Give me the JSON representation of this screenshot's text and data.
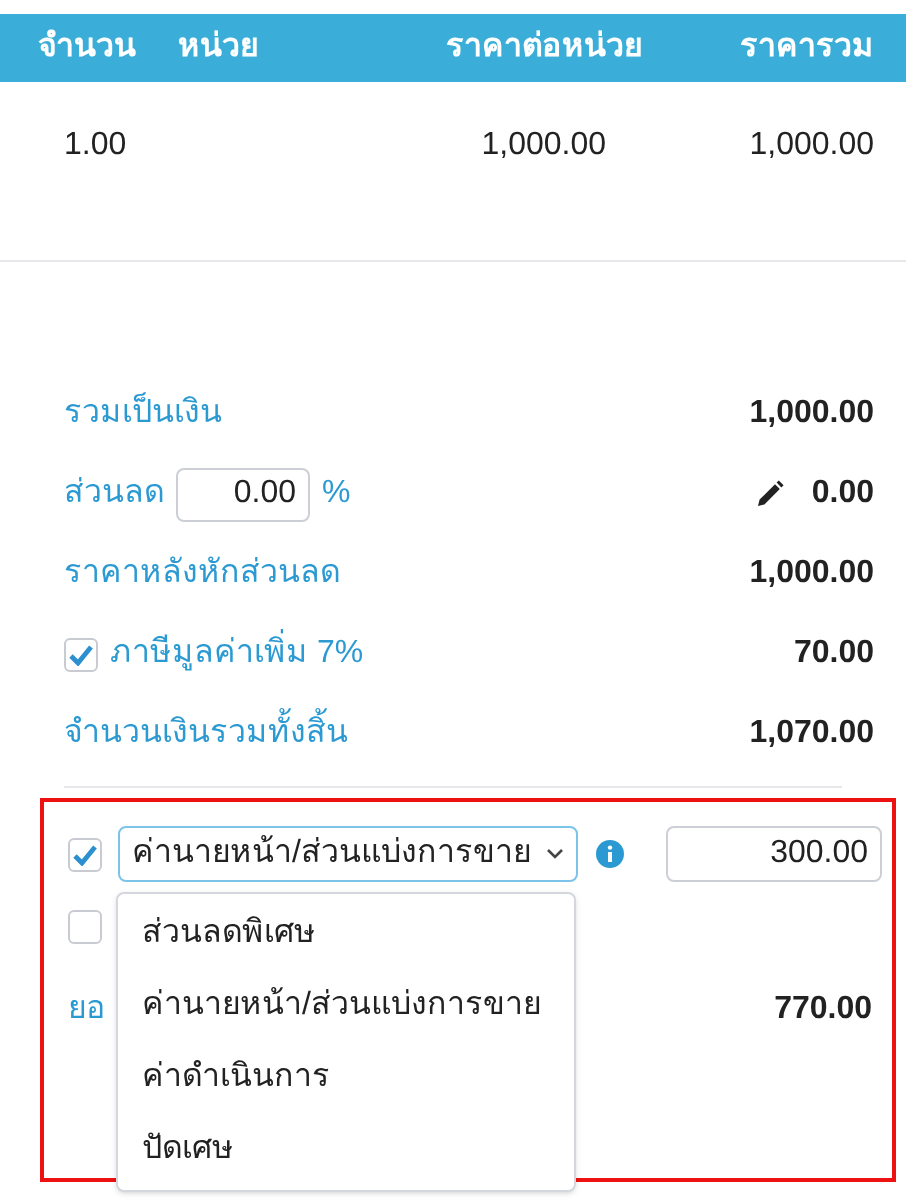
{
  "table": {
    "columns": [
      "จำนวน",
      "หน่วย",
      "ราคาต่อหน่วย",
      "ราคารวม"
    ],
    "rows": [
      {
        "quantity": "1.00",
        "unit_price": "1,000.00",
        "total": "1,000.00"
      }
    ]
  },
  "summary": [
    {
      "kind": "plain",
      "label": "รวมเป็นเงิน",
      "value": "1,000.00"
    },
    {
      "kind": "discount",
      "label": "ส่วนลด",
      "input": "0.00",
      "suffix": "%",
      "value": "0.00"
    },
    {
      "kind": "plain",
      "label": "ราคาหลังหักส่วนลด",
      "value": "1,000.00"
    },
    {
      "kind": "check",
      "label": "ภาษีมูลค่าเพิ่ม 7%",
      "checked": true,
      "value": "70.00"
    },
    {
      "kind": "plain",
      "label": "จำนวนเงินรวมทั้งสิ้น",
      "value": "1,070.00"
    }
  ],
  "deductions": [
    {
      "checked": true,
      "select": "ค่านายหน้า/ส่วนแบ่งการขาย",
      "amount": "300.00"
    },
    {
      "checked": false
    }
  ],
  "net": {
    "label": "ยอ",
    "value": "770.00"
  },
  "menu": {
    "options": [
      {
        "label": "ส่วนลดพิเศษ",
        "selected": false
      },
      {
        "label": "ค่านายหน้า/ส่วนแบ่งการขาย",
        "selected": false
      },
      {
        "label": "ค่าดำเนินการ",
        "selected": false
      },
      {
        "label": "ปัดเศษ",
        "selected": false
      }
    ]
  }
}
